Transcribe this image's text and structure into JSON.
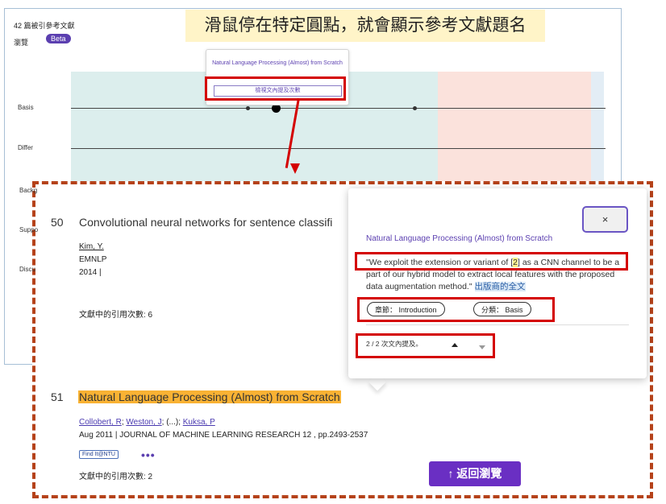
{
  "caption": "滑鼠停在特定圓點，就會顯示參考文獻題名",
  "background": {
    "count_label": "42 篇被引參考文獻",
    "browse_label": "瀏覽",
    "beta_badge": "Beta",
    "row_labels": [
      "Basis",
      "Differ",
      "Backg",
      "Suppo",
      "Discu"
    ],
    "tooltip": {
      "title": "Natural Language Processing (Almost) from Scratch",
      "button": "檢視文內提及次數"
    }
  },
  "records": [
    {
      "number": "50",
      "title": "Convolutional neural networks for sentence classifi",
      "author": "Kim, Y.",
      "venue": "EMNLP",
      "year": "2014 |",
      "cite_count": "文獻中的引用次數: 6"
    },
    {
      "number": "51",
      "title": "Natural Language Processing (Almost) from Scratch",
      "authors": [
        "Collobert, R",
        "Weston, J",
        "Kuksa, P"
      ],
      "author_sep1": "; ",
      "author_sep2": "; (...); ",
      "meta": "Aug 2011 | JOURNAL OF MACHINE LEARNING RESEARCH 12 , pp.2493-2537",
      "findit": "Find It@NTU",
      "more": "•••",
      "cite_count": "文獻中的引用次數: 2"
    }
  ],
  "back_button": "↑ 返回瀏覽",
  "popover": {
    "close": "×",
    "title": "Natural Language Processing (Almost) from Scratch",
    "quote_before": "\"We exploit the extension or variant of [",
    "quote_ref": "2",
    "quote_after": "] as a CNN channel to be a part of our hybrid model to extract local features with the proposed data augmentation method.\"",
    "publisher_link": "出版商的全文",
    "chapter_pill": "章節： Introduction",
    "category_pill": "分類： Basis",
    "nav_text": "2 / 2 次文內提及。"
  }
}
